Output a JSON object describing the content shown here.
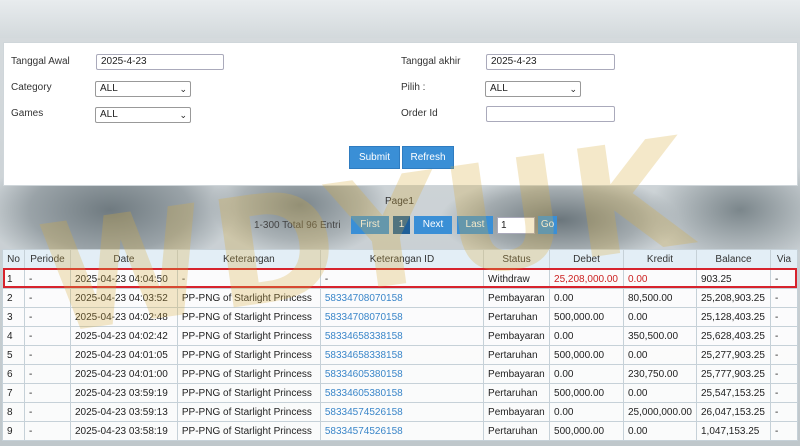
{
  "filters": {
    "start_date_label": "Tanggal Awal",
    "start_date_value": "2025-4-23",
    "end_date_label": "Tanggal akhir",
    "end_date_value": "2025-4-23",
    "category_label": "Category",
    "category_value": "ALL",
    "pilih_label": "Pilih  :",
    "pilih_value": "ALL",
    "games_label": "Games",
    "games_value": "ALL",
    "order_id_label": "Order Id",
    "order_id_value": "",
    "submit_label": "Submit",
    "refresh_label": "Refresh"
  },
  "pager": {
    "title": "Page1",
    "info": "1-300 Total 96 Entri",
    "first": "First",
    "current": "1",
    "next": "Next",
    "last": "Last",
    "page_input": "1",
    "go": "Go"
  },
  "watermark": "WDYUK",
  "table": {
    "headers": [
      "No",
      "Periode",
      "Date",
      "Keterangan",
      "Keterangan ID",
      "Status",
      "Debet",
      "Kredit",
      "Balance",
      "Via"
    ],
    "rows": [
      [
        "1",
        "-",
        "2025-04-23 04:04:50",
        "-",
        "-",
        "Withdraw",
        "25,208,000.00",
        "0.00",
        "903.25",
        "-"
      ],
      [
        "2",
        "-",
        "2025-04-23 04:03:52",
        "PP-PNG of Starlight Princess",
        "58334708070158",
        "Pembayaran",
        "0.00",
        "80,500.00",
        "25,208,903.25",
        "-"
      ],
      [
        "3",
        "-",
        "2025-04-23 04:02:48",
        "PP-PNG of Starlight Princess",
        "58334708070158",
        "Pertaruhan",
        "500,000.00",
        "0.00",
        "25,128,403.25",
        "-"
      ],
      [
        "4",
        "-",
        "2025-04-23 04:02:42",
        "PP-PNG of Starlight Princess",
        "58334658338158",
        "Pembayaran",
        "0.00",
        "350,500.00",
        "25,628,403.25",
        "-"
      ],
      [
        "5",
        "-",
        "2025-04-23 04:01:05",
        "PP-PNG of Starlight Princess",
        "58334658338158",
        "Pertaruhan",
        "500,000.00",
        "0.00",
        "25,277,903.25",
        "-"
      ],
      [
        "6",
        "-",
        "2025-04-23 04:01:00",
        "PP-PNG of Starlight Princess",
        "58334605380158",
        "Pembayaran",
        "0.00",
        "230,750.00",
        "25,777,903.25",
        "-"
      ],
      [
        "7",
        "-",
        "2025-04-23 03:59:19",
        "PP-PNG of Starlight Princess",
        "58334605380158",
        "Pertaruhan",
        "500,000.00",
        "0.00",
        "25,547,153.25",
        "-"
      ],
      [
        "8",
        "-",
        "2025-04-23 03:59:13",
        "PP-PNG of Starlight Princess",
        "58334574526158",
        "Pembayaran",
        "0.00",
        "25,000,000.00",
        "26,047,153.25",
        "-"
      ],
      [
        "9",
        "-",
        "2025-04-23 03:58:19",
        "PP-PNG of Starlight Princess",
        "58334574526158",
        "Pertaruhan",
        "500,000.00",
        "0.00",
        "1,047,153.25",
        "-"
      ]
    ]
  },
  "colors": {
    "accent": "#3a8fd6",
    "highlight": "#d7232d",
    "link": "#3a86c9"
  }
}
